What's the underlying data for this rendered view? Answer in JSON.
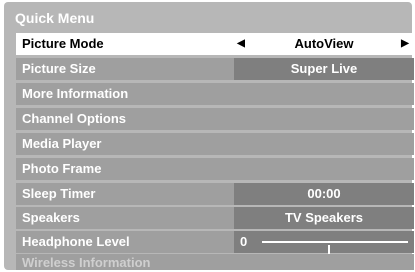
{
  "menu": {
    "title": "Quick Menu",
    "items": [
      {
        "label": "Picture Mode",
        "value": "AutoView"
      },
      {
        "label": "Picture Size",
        "value": "Super Live"
      },
      {
        "label": "More Information"
      },
      {
        "label": "Channel Options"
      },
      {
        "label": "Media Player"
      },
      {
        "label": "Photo Frame"
      },
      {
        "label": "Sleep Timer",
        "value": "00:00"
      },
      {
        "label": "Speakers",
        "value": "TV Speakers"
      },
      {
        "label": "Headphone Level",
        "value": "0",
        "level_fraction": 0.45
      },
      {
        "label": "Wireless Information"
      }
    ],
    "arrows": {
      "left": "◀",
      "right": "▶"
    }
  },
  "colors": {
    "panel": "#b7b7b7",
    "row": "#9f9f9f",
    "value_box": "#7f7f7f",
    "selected": "#ffffff"
  }
}
